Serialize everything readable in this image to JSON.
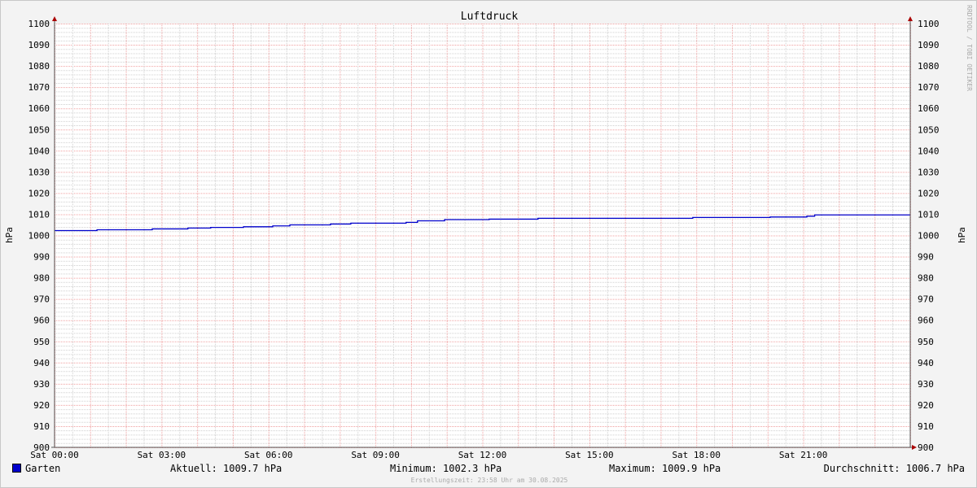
{
  "chart_data": {
    "type": "line",
    "title": "Luftdruck",
    "ylabel": "hPa",
    "ylabel_right": "hPa",
    "ylim": [
      900,
      1100
    ],
    "yticks": [
      900,
      910,
      920,
      930,
      940,
      950,
      960,
      970,
      980,
      990,
      1000,
      1010,
      1020,
      1030,
      1040,
      1050,
      1060,
      1070,
      1080,
      1090,
      1100
    ],
    "xlim_hours": [
      0,
      24
    ],
    "xticks": [
      {
        "h": 0,
        "label": "Sat 00:00"
      },
      {
        "h": 3,
        "label": "Sat 03:00"
      },
      {
        "h": 6,
        "label": "Sat 06:00"
      },
      {
        "h": 9,
        "label": "Sat 09:00"
      },
      {
        "h": 12,
        "label": "Sat 12:00"
      },
      {
        "h": 15,
        "label": "Sat 15:00"
      },
      {
        "h": 18,
        "label": "Sat 18:00"
      },
      {
        "h": 21,
        "label": "Sat 21:00"
      }
    ],
    "grid": true,
    "series": [
      {
        "name": "Garten",
        "color": "#0000cc",
        "x_hours": [
          0,
          1.19,
          2.74,
          3.74,
          4.38,
          5.3,
          6.12,
          6.6,
          7.74,
          8.31,
          9.86,
          10.18,
          10.94,
          12.19,
          13.56,
          17.9,
          20.07,
          21.1,
          21.32,
          24
        ],
        "values": [
          1002.3,
          1002.7,
          1003.1,
          1003.5,
          1003.8,
          1004.1,
          1004.5,
          1005.0,
          1005.4,
          1005.8,
          1006.2,
          1006.9,
          1007.5,
          1007.7,
          1008.1,
          1008.5,
          1008.7,
          1009.1,
          1009.7,
          1009.7
        ]
      }
    ],
    "watermark": "RRDTOOL / TOBI OETIKER"
  },
  "legend": {
    "name": "Garten",
    "current": "Aktuell: 1009.7 hPa",
    "minimum": "Minimum: 1002.3 hPa",
    "maximum": "Maximum: 1009.9 hPa",
    "average": "Durchschnitt: 1006.7 hPa"
  },
  "footer": "Erstellungszeit: 23:58 Uhr am 30.08.2025"
}
